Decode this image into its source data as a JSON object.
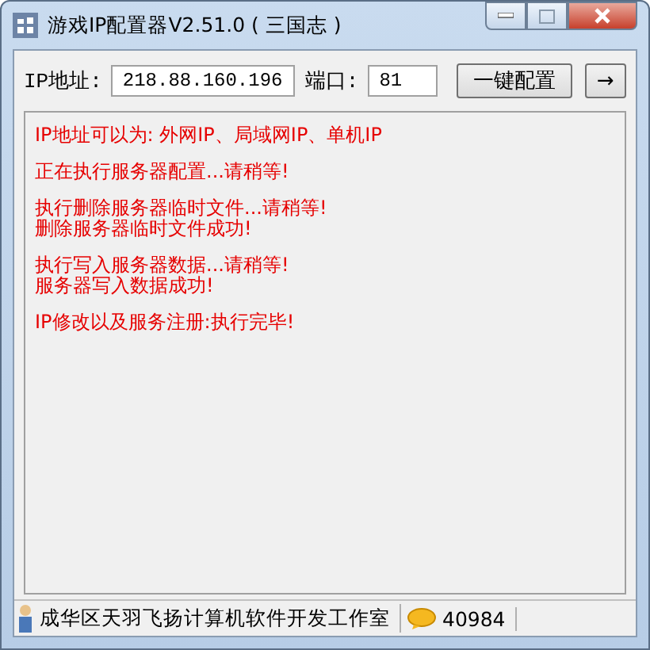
{
  "window": {
    "title": "游戏IP配置器V2.51.0 ( 三国志 )"
  },
  "toolbar": {
    "ip_label": "IP地址:",
    "ip_value": "218.88.160.196",
    "port_label": "端口:",
    "port_value": "81",
    "config_button": "一键配置",
    "arrow_button": "→"
  },
  "log": [
    [
      "IP地址可以为:  外网IP、局域网IP、单机IP"
    ],
    [
      "正在执行服务器配置...请稍等!"
    ],
    [
      "执行删除服务器临时文件...请稍等!",
      "删除服务器临时文件成功!"
    ],
    [
      "执行写入服务器数据...请稍等!",
      "服务器写入数据成功!"
    ],
    [
      "IP修改以及服务注册:执行完毕!"
    ]
  ],
  "status_bar": [
    {
      "kind": "person",
      "text": "成华区天羽飞扬计算机软件开发工作室"
    },
    {
      "kind": "chat",
      "text": "40984"
    }
  ]
}
